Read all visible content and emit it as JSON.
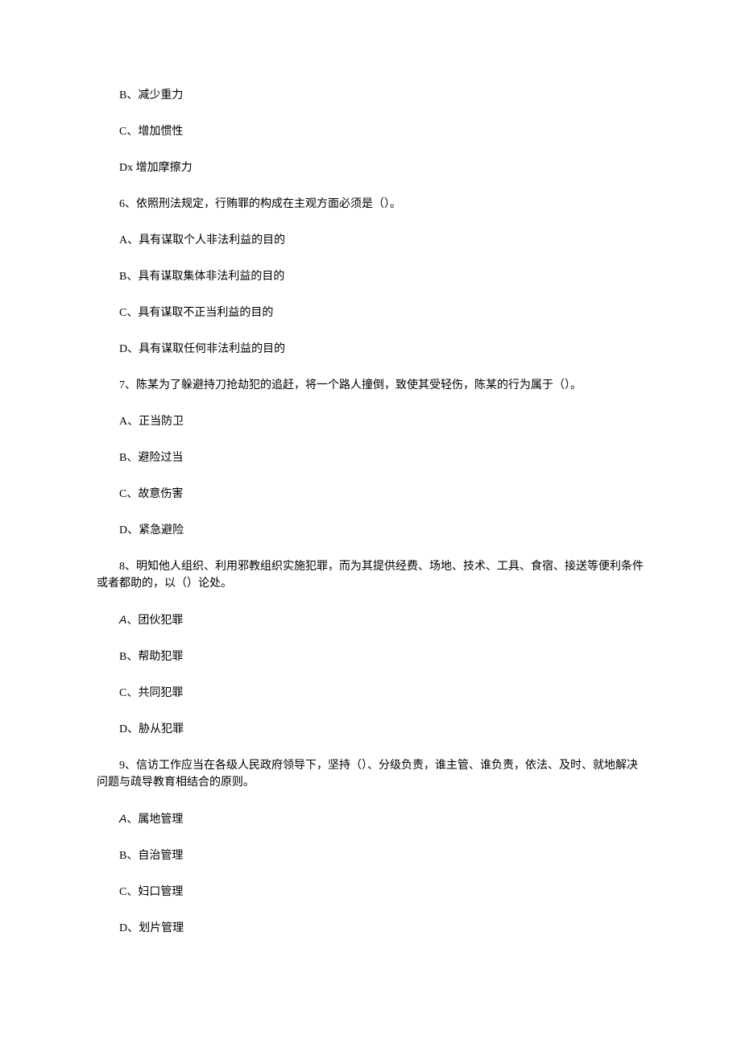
{
  "lines": [
    {
      "text": "B、减少重力"
    },
    {
      "text": "C、增加惯性"
    },
    {
      "text": "Dx 增加摩擦力"
    },
    {
      "text": "6、依照刑法规定，行贿罪的构成在主观方面必须是（）。"
    },
    {
      "text": "A、具有谋取个人非法利益的目的"
    },
    {
      "text": "B、具有谋取集体非法利益的目的"
    },
    {
      "text": "C、具有谋取不正当利益的目的"
    },
    {
      "text": "D、具有谋取任何非法利益的目的"
    },
    {
      "text": "7、陈某为了躲避持刀抢劫犯的追赶，将一个路人撞倒，致使其受轻伤，陈某的行为属于（）。"
    },
    {
      "text": "A、正当防卫"
    },
    {
      "text": "B、避险过当"
    },
    {
      "text": "C、故意伤害"
    },
    {
      "text": "D、紧急避险"
    },
    {
      "text": "8、明知他人组织、利用邪教组织实施犯罪，而为其提供经费、场地、技术、工具、食宿、接送等便利条件或者都助的，以（）论处。"
    },
    {
      "text": "、团伙犯罪",
      "prefix": "A"
    },
    {
      "text": "B、帮助犯罪"
    },
    {
      "text": "C、共同犯罪"
    },
    {
      "text": "D、胁从犯罪"
    },
    {
      "text": "9、信访工作应当在各级人民政府领导下，坚持（）、分级负责，谁主管、谁负责，依法、及时、就地解决问题与疏导教育相结合的原则。"
    },
    {
      "text": "、属地管理",
      "prefix": "A"
    },
    {
      "text": "B、自治管理"
    },
    {
      "text": "C、妇口管理"
    },
    {
      "text": "D、划片管理"
    }
  ]
}
